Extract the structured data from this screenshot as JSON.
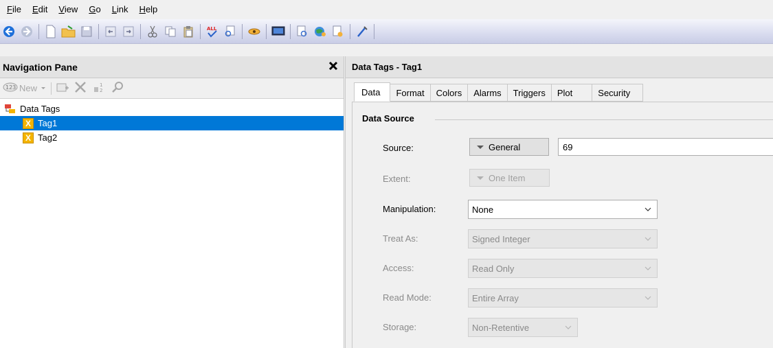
{
  "menu": {
    "file": "File",
    "edit": "Edit",
    "view": "View",
    "go": "Go",
    "link": "Link",
    "help": "Help"
  },
  "toolbar": {
    "icons": [
      "back-icon",
      "forward-icon",
      "new-document-icon",
      "open-folder-icon",
      "save-icon",
      "undo-icon",
      "redo-icon",
      "cut-icon",
      "copy-icon",
      "paste-icon",
      "spellcheck-icon",
      "find-replace-icon",
      "link-icon",
      "monitor-icon",
      "print-preview-icon",
      "web-icon",
      "page-icon",
      "tool-icon"
    ]
  },
  "nav": {
    "title": "Navigation Pane",
    "new_label": "New",
    "tree": {
      "root": "Data Tags",
      "items": [
        "Tag1",
        "Tag2"
      ]
    }
  },
  "panel": {
    "title": "Data Tags - Tag1",
    "tabs": [
      "Data",
      "Format",
      "Colors",
      "Alarms",
      "Triggers",
      "Plot",
      "Security"
    ],
    "group_title": "Data Source",
    "source": {
      "label": "Source:",
      "button": "General",
      "value": "69"
    },
    "extent": {
      "label": "Extent:",
      "button": "One Item"
    },
    "manipulation": {
      "label": "Manipulation:",
      "value": "None"
    },
    "treat_as": {
      "label": "Treat As:",
      "value": "Signed Integer"
    },
    "access": {
      "label": "Access:",
      "value": "Read Only"
    },
    "read_mode": {
      "label": "Read Mode:",
      "value": "Entire Array"
    },
    "storage": {
      "label": "Storage:",
      "value": "Non-Retentive"
    }
  },
  "colors": {
    "selection": "#0078d7",
    "tag_icon": "#f4b400"
  }
}
